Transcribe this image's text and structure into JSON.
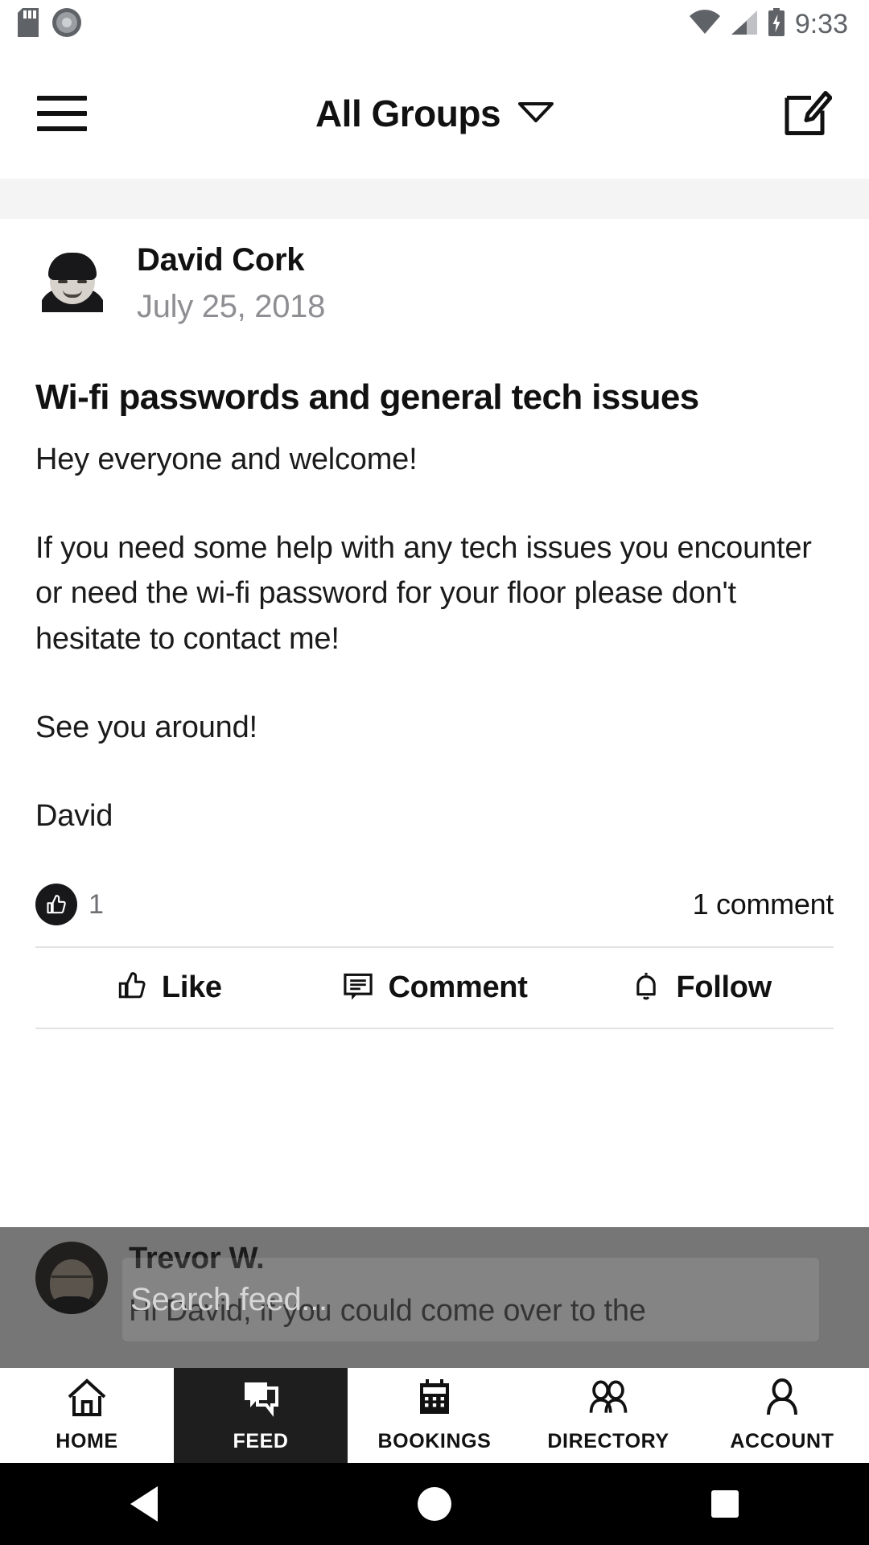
{
  "status_bar": {
    "time": "9:33",
    "icons_left": [
      "sd-card-icon",
      "disc-icon"
    ],
    "icons_right": [
      "wifi-icon",
      "cellular-signal-icon",
      "battery-charging-icon"
    ]
  },
  "app_bar": {
    "menu_icon": "hamburger-menu-icon",
    "title": "All Groups",
    "dropdown_icon": "chevron-down-icon",
    "compose_icon": "compose-icon"
  },
  "post": {
    "author": "David Cork",
    "date": "July 25, 2018",
    "title": "Wi-fi passwords and general tech issues",
    "paragraphs": [
      "Hey everyone and welcome!",
      "If you need some help with any tech issues you encounter or need the wi-fi password for your floor please don't hesitate to contact me!",
      "See you around!",
      "David"
    ],
    "like_count": "1",
    "comment_count": "1 comment",
    "actions": [
      {
        "label": "Like",
        "icon": "thumbs-up-outline-icon"
      },
      {
        "label": "Comment",
        "icon": "comment-bubble-icon"
      },
      {
        "label": "Follow",
        "icon": "bell-icon"
      }
    ]
  },
  "next_post": {
    "author": "Trevor W.",
    "excerpt": "Hi David, if you could come over to the"
  },
  "search": {
    "placeholder": "Search feed..."
  },
  "bottom_nav": {
    "items": [
      {
        "label": "HOME",
        "icon": "home-icon",
        "active": false
      },
      {
        "label": "FEED",
        "icon": "feed-chat-icon",
        "active": true
      },
      {
        "label": "BOOKINGS",
        "icon": "calendar-icon",
        "active": false
      },
      {
        "label": "DIRECTORY",
        "icon": "people-icon",
        "active": false
      },
      {
        "label": "ACCOUNT",
        "icon": "person-icon",
        "active": false
      }
    ]
  },
  "system_nav": {
    "back": "back-triangle-icon",
    "home": "home-circle-icon",
    "recents": "recents-square-icon"
  },
  "colors": {
    "accent_dark": "#1e1e1e",
    "text_primary": "#111111",
    "text_muted": "#8e8e93",
    "band": "#f4f4f4"
  }
}
